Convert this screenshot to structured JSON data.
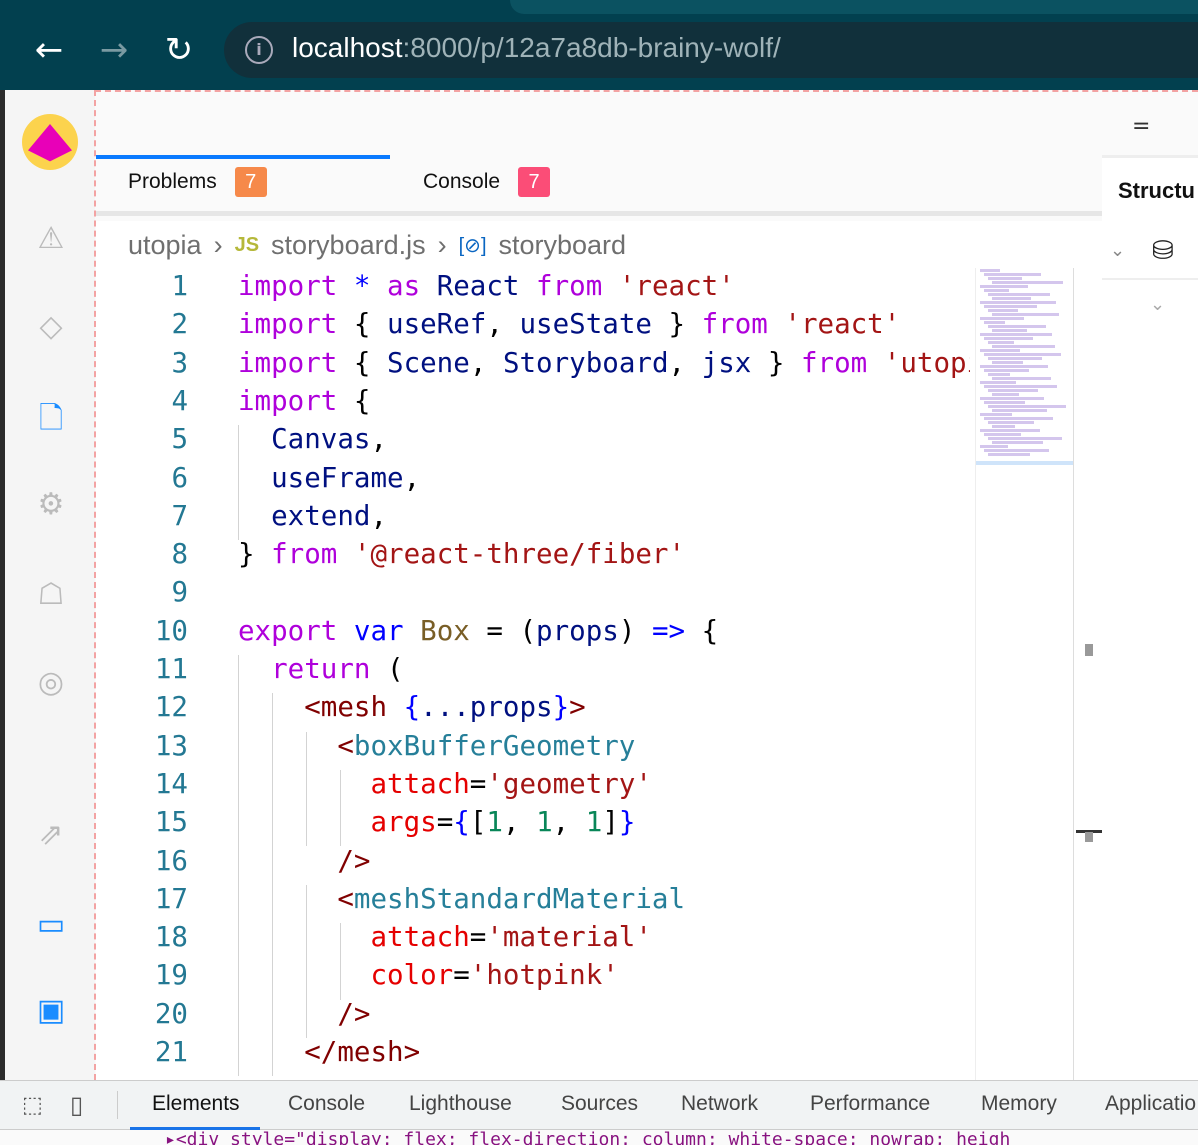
{
  "browser": {
    "url_host": "localhost",
    "url_rest": ":8000/p/12a7a8db-brainy-wolf/"
  },
  "tabs": [
    {
      "label": "Problems",
      "count": "7",
      "color": "#f6894a"
    },
    {
      "label": "Console",
      "count": "7",
      "color": "#fb4d77"
    }
  ],
  "breadcrumb": {
    "root": "utopia",
    "file_badge": "JS",
    "file": "storyboard.js",
    "symbol": "storyboard"
  },
  "right_panel": {
    "title": "Structu"
  },
  "code": [
    [
      [
        "import",
        "kw"
      ],
      [
        " * ",
        "op"
      ],
      [
        "as",
        "kw"
      ],
      [
        " React ",
        "id"
      ],
      [
        "from",
        "kw"
      ],
      [
        " 'react'",
        "str"
      ]
    ],
    [
      [
        "import",
        "kw"
      ],
      [
        " { ",
        "tx"
      ],
      [
        "useRef",
        "id"
      ],
      [
        ", ",
        "tx"
      ],
      [
        "useState",
        "id"
      ],
      [
        " } ",
        "tx"
      ],
      [
        "from",
        "kw"
      ],
      [
        " 'react'",
        "str"
      ]
    ],
    [
      [
        "import",
        "kw"
      ],
      [
        " { ",
        "tx"
      ],
      [
        "Scene",
        "id"
      ],
      [
        ", ",
        "tx"
      ],
      [
        "Storyboard",
        "id"
      ],
      [
        ", ",
        "tx"
      ],
      [
        "jsx",
        "id"
      ],
      [
        " } ",
        "tx"
      ],
      [
        "from",
        "kw"
      ],
      [
        " 'utopia-api'",
        "str"
      ]
    ],
    [
      [
        "import",
        "kw"
      ],
      [
        " {",
        "tx"
      ]
    ],
    [
      [
        "  Canvas",
        "id"
      ],
      [
        ",",
        "tx"
      ]
    ],
    [
      [
        "  useFrame",
        "id"
      ],
      [
        ",",
        "tx"
      ]
    ],
    [
      [
        "  extend",
        "id"
      ],
      [
        ",",
        "tx"
      ]
    ],
    [
      [
        "} ",
        "tx"
      ],
      [
        "from",
        "kw"
      ],
      [
        " '@react-three/fiber'",
        "str"
      ]
    ],
    [],
    [
      [
        "export",
        "kw"
      ],
      [
        " var ",
        "op"
      ],
      [
        "Box",
        "fn"
      ],
      [
        " = (",
        "tx"
      ],
      [
        "props",
        "id"
      ],
      [
        ") ",
        "tx"
      ],
      [
        "=>",
        "op"
      ],
      [
        " {",
        "tx"
      ]
    ],
    [
      [
        "  return",
        "kw"
      ],
      [
        " (",
        "tx"
      ]
    ],
    [
      [
        "    <mesh ",
        "tag"
      ],
      [
        "{",
        "br"
      ],
      [
        "...props",
        "id"
      ],
      [
        "}",
        "br"
      ],
      [
        ">",
        "tag"
      ]
    ],
    [
      [
        "      <",
        "tag"
      ],
      [
        "boxBufferGeometry",
        "comp"
      ]
    ],
    [
      [
        "        attach",
        "attr"
      ],
      [
        "=",
        "tx"
      ],
      [
        "'geometry'",
        "str"
      ]
    ],
    [
      [
        "        args",
        "attr"
      ],
      [
        "=",
        "tx"
      ],
      [
        "{",
        "br"
      ],
      [
        "[",
        "tx"
      ],
      [
        "1",
        "num"
      ],
      [
        ", ",
        "tx"
      ],
      [
        "1",
        "num"
      ],
      [
        ", ",
        "tx"
      ],
      [
        "1",
        "num"
      ],
      [
        "]",
        "tx"
      ],
      [
        "}",
        "br"
      ]
    ],
    [
      [
        "      />",
        "tag"
      ]
    ],
    [
      [
        "      <",
        "tag"
      ],
      [
        "meshStandardMaterial",
        "comp"
      ]
    ],
    [
      [
        "        attach",
        "attr"
      ],
      [
        "=",
        "tx"
      ],
      [
        "'material'",
        "str"
      ]
    ],
    [
      [
        "        color",
        "attr"
      ],
      [
        "=",
        "tx"
      ],
      [
        "'hotpink'",
        "str"
      ]
    ],
    [
      [
        "      />",
        "tag"
      ]
    ],
    [
      [
        "    </mesh>",
        "tag"
      ]
    ]
  ],
  "devtools": {
    "tabs": [
      "Elements",
      "Console",
      "Lighthouse",
      "Sources",
      "Network",
      "Performance",
      "Memory",
      "Applicatio"
    ],
    "element_line": "▸<div style=\"display: flex; flex-direction: column; white-space: nowrap; heigh"
  }
}
